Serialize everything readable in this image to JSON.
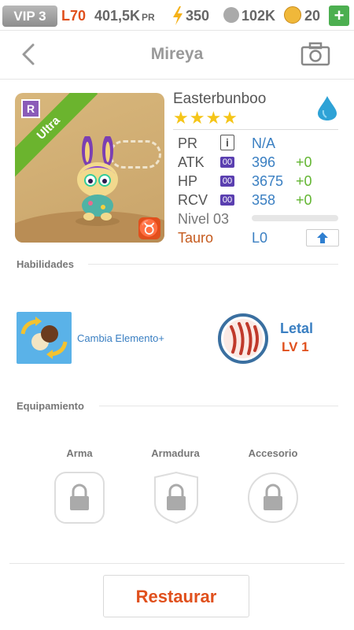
{
  "topbar": {
    "vip": "VIP 3",
    "level": "L70",
    "power": "401,5K",
    "power_unit": "PR",
    "energy": "350",
    "paws": "102K",
    "coins": "20",
    "add": "+"
  },
  "nav": {
    "title": "Mireya"
  },
  "hero": {
    "name": "Easterbunboo",
    "stars": "★★★★",
    "rarity": "Ultra",
    "rarity_badge": "R",
    "zodiac_symbol": "♉"
  },
  "stats": {
    "pr_label": "PR",
    "pr_badge": "i",
    "pr_value": "N/A",
    "atk_label": "ATK",
    "atk_badge": "00",
    "atk_value": "396",
    "atk_bonus": "+0",
    "hp_label": "HP",
    "hp_badge": "00",
    "hp_value": "3675",
    "hp_bonus": "+0",
    "rcv_label": "RCV",
    "rcv_badge": "00",
    "rcv_value": "358",
    "rcv_bonus": "+0",
    "level_label": "Nivel 03",
    "level_progress": 0,
    "zodiac": "Tauro",
    "limit": "L0"
  },
  "abilities": {
    "heading": "Habilidades",
    "skill_name": "Cambia Elemento+",
    "lethal_name": "Letal",
    "lethal_level": "LV 1"
  },
  "equipment": {
    "heading": "Equipamiento",
    "weapon": "Arma",
    "armor": "Armadura",
    "accessory": "Accesorio"
  },
  "actions": {
    "restore": "Restaurar"
  },
  "colors": {
    "accent_orange": "#e0501d",
    "stat_blue": "#3a7fc2",
    "bonus_green": "#62b531",
    "ultra_green": "#6bb42e",
    "star_gold": "#f5c518"
  }
}
